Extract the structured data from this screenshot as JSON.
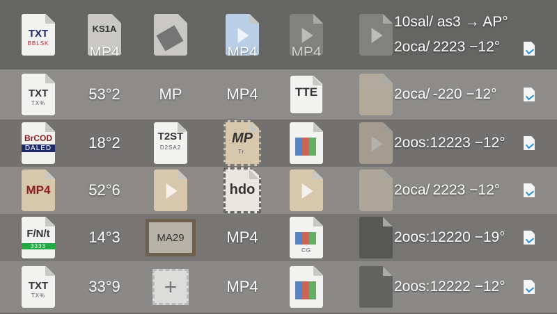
{
  "rows": [
    {
      "c0": {
        "main": "TXT",
        "sub": "BBLSK"
      },
      "c1": {
        "main": "KS1A",
        "overlay": "MP4"
      },
      "c3": {
        "overlay": "MP4"
      },
      "c4": {
        "overlay": "MP4"
      },
      "meta1": "10sal/ as3 → AP°",
      "meta2": "2oca/ 2223 −12°"
    },
    {
      "c0": {
        "main": "TXT",
        "sub": "TX%"
      },
      "c1": {
        "text": "53°2"
      },
      "c2": {
        "text": "MP"
      },
      "c3": {
        "text": "MP4"
      },
      "c4": {
        "main": "TTE"
      },
      "meta1": "2oca/ -220 −12°"
    },
    {
      "c0": {
        "main": "BrCOD",
        "sub": "DALED"
      },
      "c1": {
        "text": "18°2"
      },
      "c2": {
        "main": "T2ST",
        "sub": "D2SA2"
      },
      "c3": {
        "main": "MP",
        "sub": "Tr."
      },
      "meta1": "2oos:12223 −12°"
    },
    {
      "c0": {
        "main": "MP4"
      },
      "c1": {
        "text": "52°6"
      },
      "c3": {
        "main": "hdo"
      },
      "meta1": "2oca/ 2223 −12°"
    },
    {
      "c0": {
        "main": "F/​N/t",
        "sub": "3333"
      },
      "c1": {
        "text": "14°3"
      },
      "c2": {
        "text": "MA29"
      },
      "c3": {
        "text": "MP4"
      },
      "c4": {
        "sub": "CG"
      },
      "meta1": "2oos:12220 −19°"
    },
    {
      "c0": {
        "main": "TXT",
        "sub": "TX%"
      },
      "c1": {
        "text": "33°9"
      },
      "c2": {
        "main": "+"
      },
      "c3": {
        "text": "MP4"
      },
      "meta1": "2oos:12222 −12°"
    }
  ],
  "icons": {
    "file": "file-icon",
    "video": "video-file-icon",
    "image": "image-file-icon",
    "doc": "document-check-icon"
  }
}
